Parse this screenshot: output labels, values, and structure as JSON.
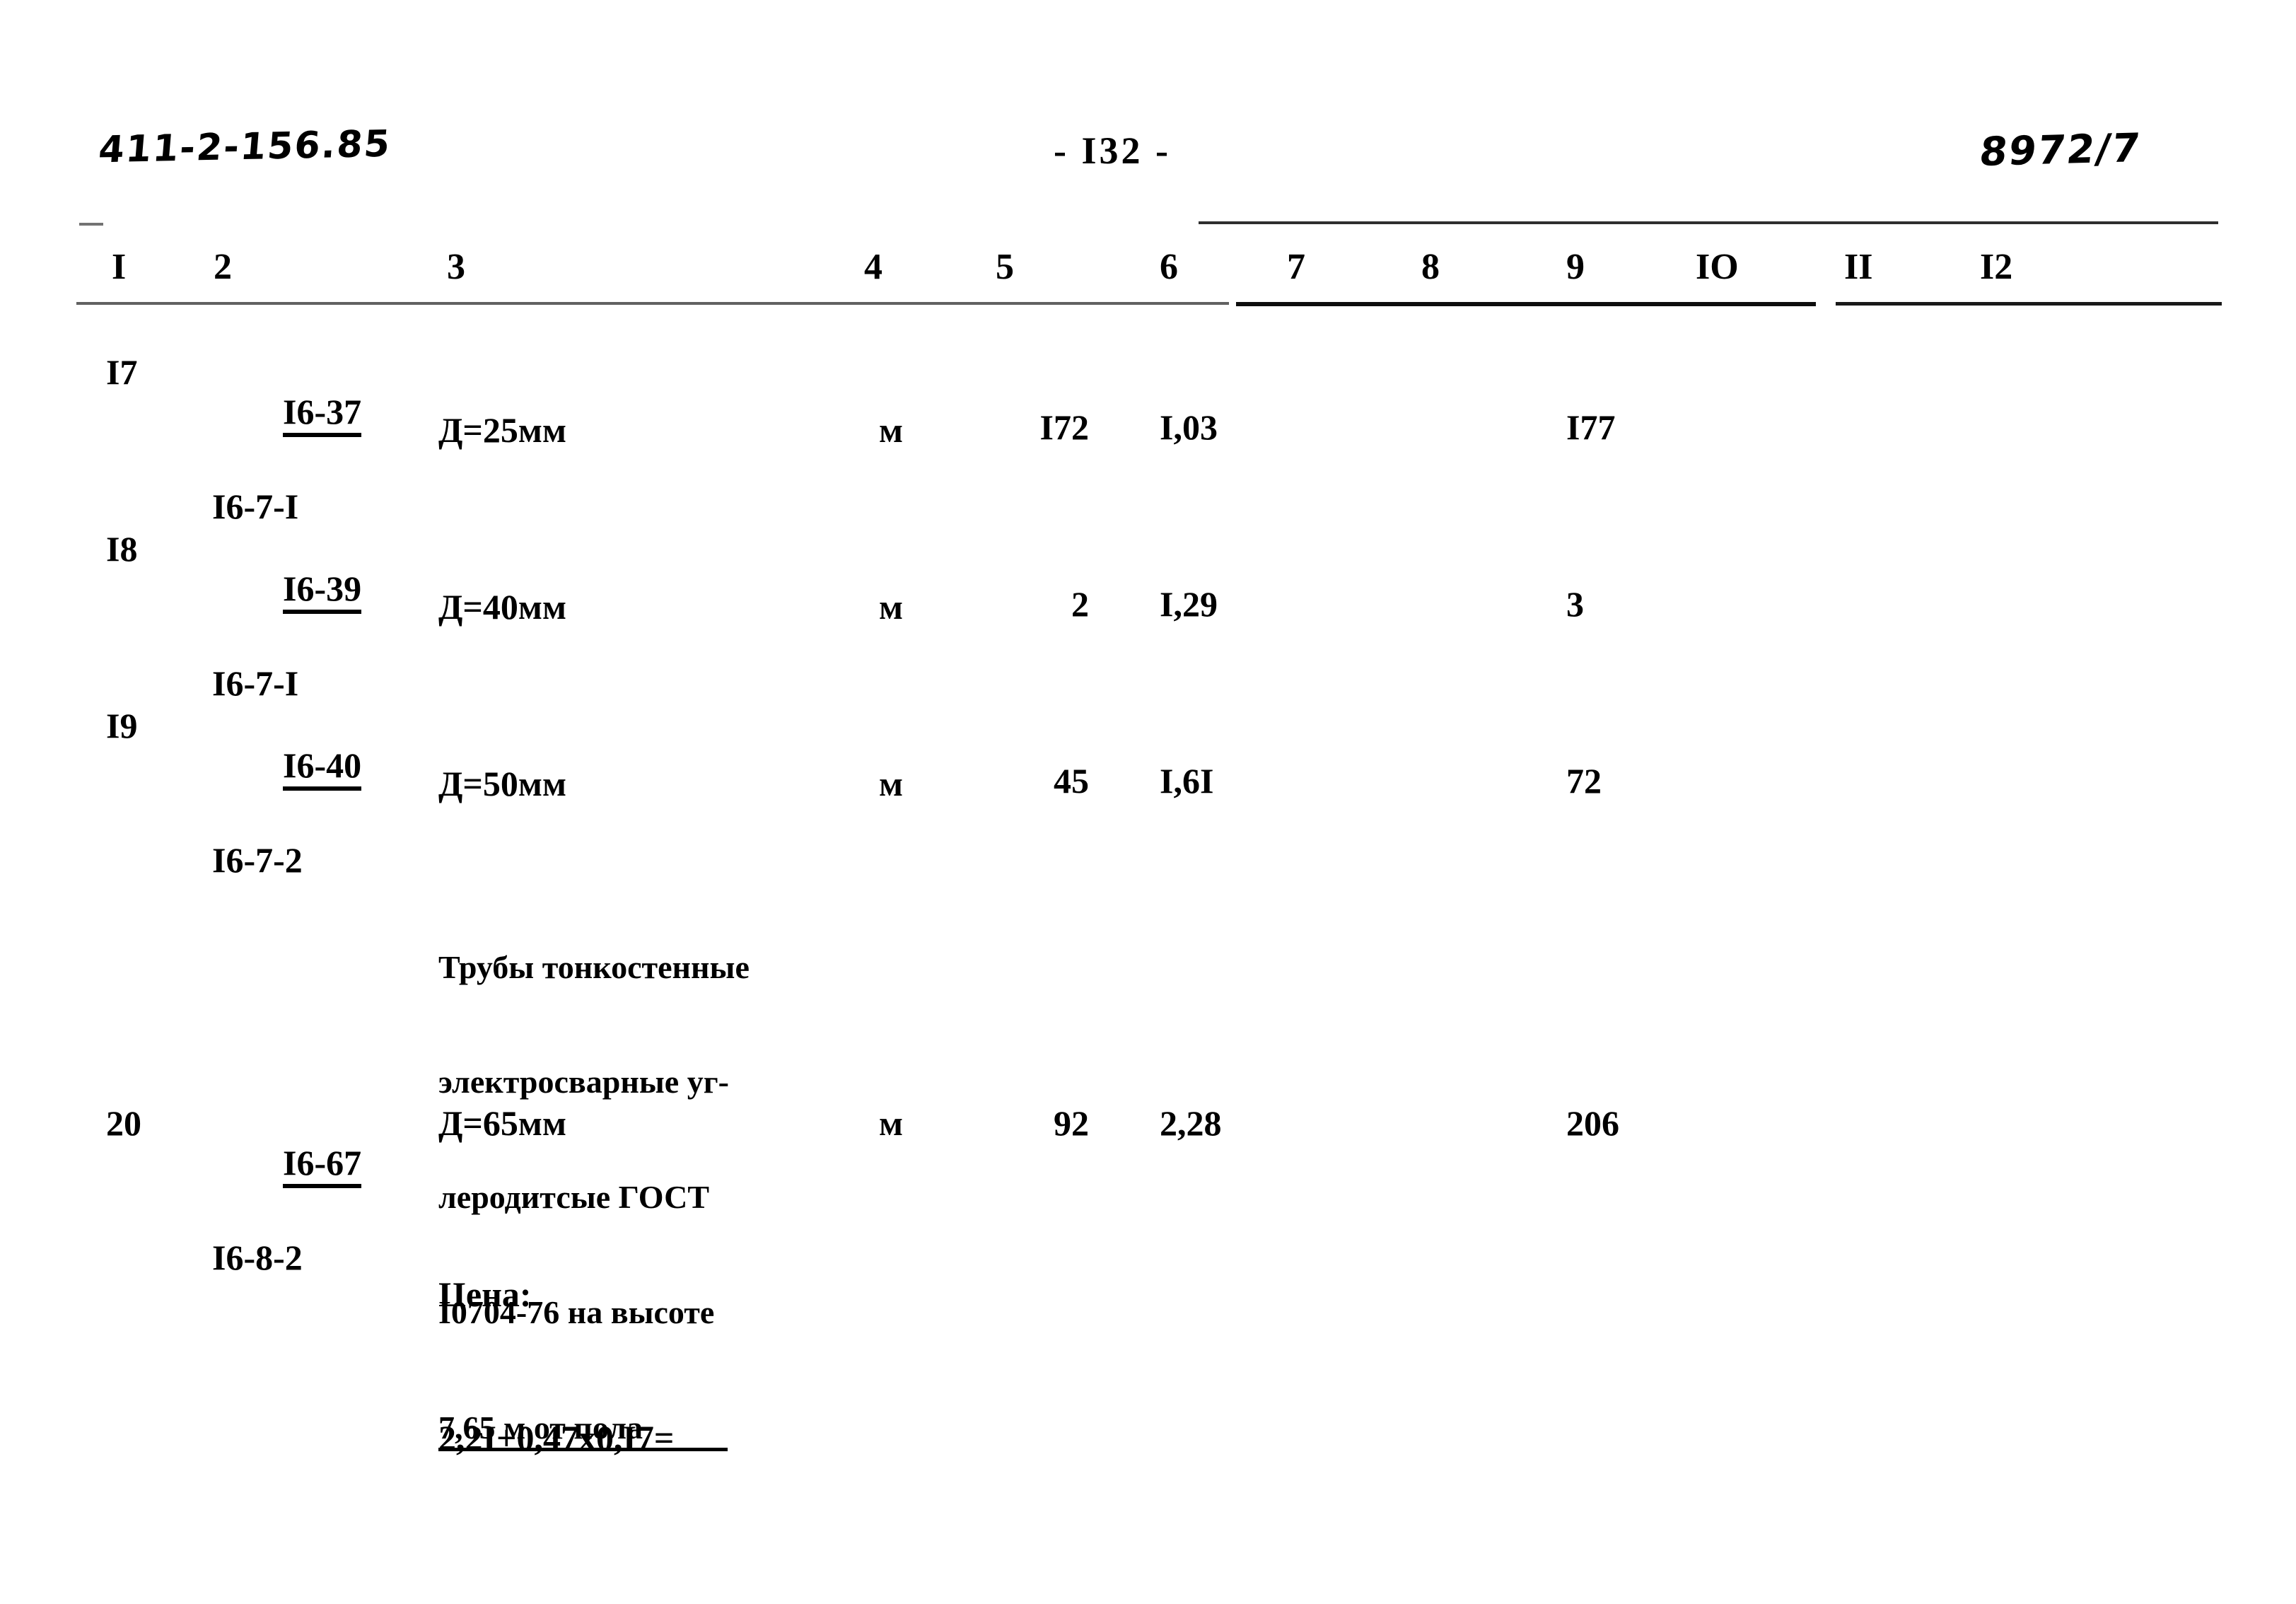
{
  "document": {
    "code": "411-2-156.85",
    "page_label": "- I32 -",
    "sheet_code": "8972/7"
  },
  "table": {
    "column_headers": [
      "I",
      "2",
      "3",
      "4",
      "5",
      "6",
      "7",
      "8",
      "9",
      "IO",
      "II",
      "I2"
    ],
    "rows": [
      {
        "num": "I7",
        "code_top": "I6-37",
        "code_bottom": "I6-7-I",
        "description": "Д=25мм",
        "unit": "м",
        "quantity": "I72",
        "price": "I,03",
        "col7": "",
        "col8": "",
        "total": "I77",
        "col10": "",
        "col11": "",
        "col12": ""
      },
      {
        "num": "I8",
        "code_top": "I6-39",
        "code_bottom": "I6-7-I",
        "description": "Д=40мм",
        "unit": "м",
        "quantity": "2",
        "price": "I,29",
        "col7": "",
        "col8": "",
        "total": "3",
        "col10": "",
        "col11": "",
        "col12": ""
      },
      {
        "num": "I9",
        "code_top": "I6-40",
        "code_bottom": "I6-7-2",
        "description": "Д=50мм",
        "unit": "м",
        "quantity": "45",
        "price": "I,6I",
        "col7": "",
        "col8": "",
        "total": "72",
        "col10": "",
        "col11": "",
        "col12": ""
      },
      {
        "num": "20",
        "code_top": "I6-67",
        "code_bottom": "I6-8-2",
        "description": "Д=65мм",
        "unit": "м",
        "quantity": "92",
        "price": "2,28",
        "col7": "",
        "col8": "",
        "total": "206",
        "col10": "",
        "col11": "",
        "col12": ""
      }
    ],
    "section_heading": {
      "line1": "Трубы тонкостенные",
      "line2": "электросварные уг-",
      "line3": "леродитсые ГОСТ",
      "line4": "I0704-76 на высоте",
      "line5": "7,65 м от пола"
    },
    "price_note": {
      "label": "Цена:",
      "formula": "2,2I+0,47x0,I7="
    }
  }
}
